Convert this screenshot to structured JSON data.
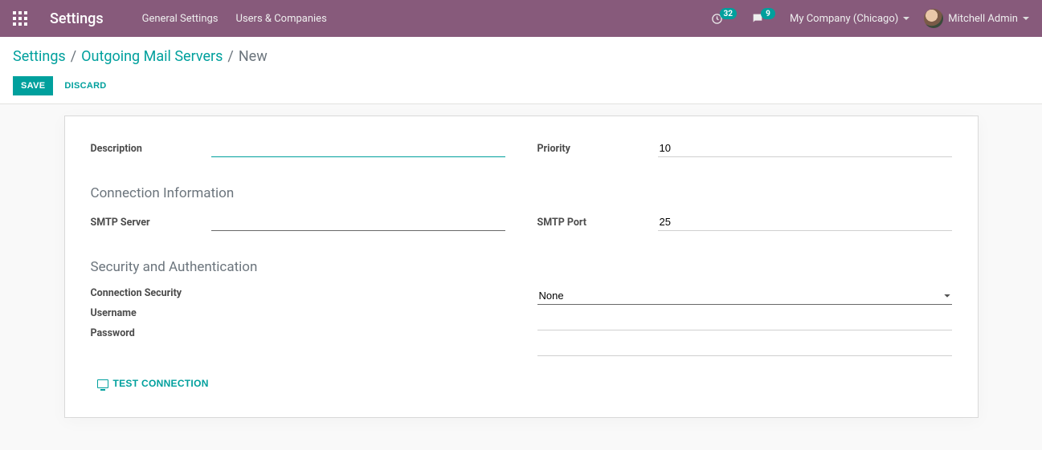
{
  "navbar": {
    "brand": "Settings",
    "links": [
      "General Settings",
      "Users & Companies"
    ],
    "activity_count": "32",
    "discuss_count": "9",
    "company": "My Company (Chicago)",
    "user": "Mitchell Admin"
  },
  "breadcrumb": {
    "items": [
      "Settings",
      "Outgoing Mail Servers"
    ],
    "current": "New"
  },
  "buttons": {
    "save": "Save",
    "discard": "Discard",
    "test_connection": "Test Connection"
  },
  "form": {
    "description_label": "Description",
    "description_value": "",
    "priority_label": "Priority",
    "priority_value": "10",
    "section_connection": "Connection Information",
    "smtp_server_label": "SMTP Server",
    "smtp_server_value": "",
    "smtp_port_label": "SMTP Port",
    "smtp_port_value": "25",
    "section_security": "Security and Authentication",
    "conn_security_label": "Connection Security",
    "conn_security_value": "None",
    "username_label": "Username",
    "username_value": "",
    "password_label": "Password",
    "password_value": ""
  }
}
